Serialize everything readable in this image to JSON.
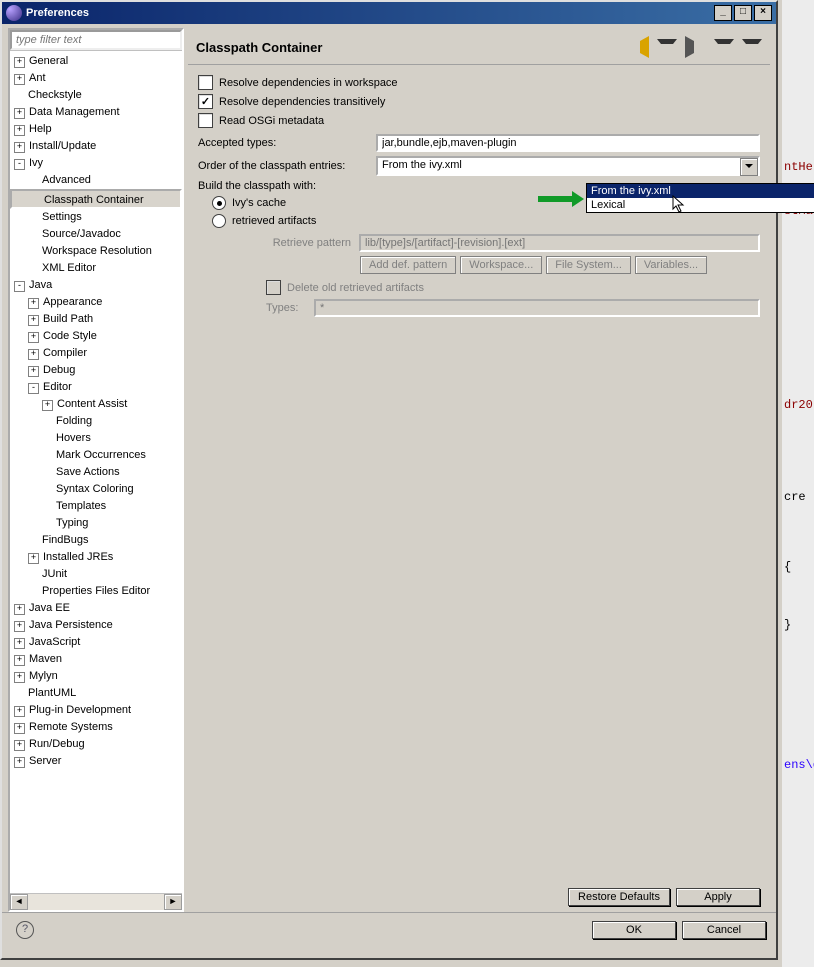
{
  "window": {
    "title": "Preferences"
  },
  "filter": {
    "placeholder": "type filter text"
  },
  "tree": {
    "items": [
      {
        "d": 0,
        "tw": "+",
        "label": "General"
      },
      {
        "d": 0,
        "tw": "+",
        "label": "Ant"
      },
      {
        "d": 0,
        "tw": "",
        "label": "Checkstyle"
      },
      {
        "d": 0,
        "tw": "+",
        "label": "Data Management"
      },
      {
        "d": 0,
        "tw": "+",
        "label": "Help"
      },
      {
        "d": 0,
        "tw": "+",
        "label": "Install/Update"
      },
      {
        "d": 0,
        "tw": "-",
        "label": "Ivy"
      },
      {
        "d": 1,
        "tw": "",
        "label": "Advanced"
      },
      {
        "d": 1,
        "tw": "",
        "label": "Classpath Container",
        "sel": true
      },
      {
        "d": 1,
        "tw": "",
        "label": "Settings"
      },
      {
        "d": 1,
        "tw": "",
        "label": "Source/Javadoc"
      },
      {
        "d": 1,
        "tw": "",
        "label": "Workspace Resolution"
      },
      {
        "d": 1,
        "tw": "",
        "label": "XML Editor"
      },
      {
        "d": 0,
        "tw": "-",
        "label": "Java"
      },
      {
        "d": 1,
        "tw": "+",
        "label": "Appearance"
      },
      {
        "d": 1,
        "tw": "+",
        "label": "Build Path"
      },
      {
        "d": 1,
        "tw": "+",
        "label": "Code Style"
      },
      {
        "d": 1,
        "tw": "+",
        "label": "Compiler"
      },
      {
        "d": 1,
        "tw": "+",
        "label": "Debug"
      },
      {
        "d": 1,
        "tw": "-",
        "label": "Editor"
      },
      {
        "d": 2,
        "tw": "+",
        "label": "Content Assist"
      },
      {
        "d": 2,
        "tw": "",
        "label": "Folding"
      },
      {
        "d": 2,
        "tw": "",
        "label": "Hovers"
      },
      {
        "d": 2,
        "tw": "",
        "label": "Mark Occurrences"
      },
      {
        "d": 2,
        "tw": "",
        "label": "Save Actions"
      },
      {
        "d": 2,
        "tw": "",
        "label": "Syntax Coloring"
      },
      {
        "d": 2,
        "tw": "",
        "label": "Templates"
      },
      {
        "d": 2,
        "tw": "",
        "label": "Typing"
      },
      {
        "d": 1,
        "tw": "",
        "label": "FindBugs"
      },
      {
        "d": 1,
        "tw": "+",
        "label": "Installed JREs"
      },
      {
        "d": 1,
        "tw": "",
        "label": "JUnit"
      },
      {
        "d": 1,
        "tw": "",
        "label": "Properties Files Editor"
      },
      {
        "d": 0,
        "tw": "+",
        "label": "Java EE"
      },
      {
        "d": 0,
        "tw": "+",
        "label": "Java Persistence"
      },
      {
        "d": 0,
        "tw": "+",
        "label": "JavaScript"
      },
      {
        "d": 0,
        "tw": "+",
        "label": "Maven"
      },
      {
        "d": 0,
        "tw": "+",
        "label": "Mylyn"
      },
      {
        "d": 0,
        "tw": "",
        "label": "PlantUML"
      },
      {
        "d": 0,
        "tw": "+",
        "label": "Plug-in Development"
      },
      {
        "d": 0,
        "tw": "+",
        "label": "Remote Systems"
      },
      {
        "d": 0,
        "tw": "+",
        "label": "Run/Debug"
      },
      {
        "d": 0,
        "tw": "+",
        "label": "Server"
      }
    ]
  },
  "page": {
    "title": "Classpath Container",
    "resolve_workspace": "Resolve dependencies in workspace",
    "resolve_transitive": "Resolve dependencies transitively",
    "read_osgi": "Read OSGi metadata",
    "accepted_types_label": "Accepted types:",
    "accepted_types_value": "jar,bundle,ejb,maven-plugin",
    "order_label": "Order of the classpath entries:",
    "order_value": "From the ivy.xml",
    "order_options": [
      "From the ivy.xml",
      "Lexical"
    ],
    "build_with_label": "Build the classpath with:",
    "radio_cache": "Ivy's cache",
    "radio_retrieved": "retrieved artifacts",
    "retrieve_pattern_label": "Retrieve pattern",
    "retrieve_pattern_placeholder": "lib/[type]s/[artifact]-[revision].[ext]",
    "btn_add_def": "Add def. pattern",
    "btn_workspace": "Workspace...",
    "btn_filesystem": "File System...",
    "btn_variables": "Variables...",
    "delete_old": "Delete old retrieved artifacts",
    "types_label": "Types:",
    "types_placeholder": "*"
  },
  "buttons": {
    "restore": "Restore Defaults",
    "apply": "Apply",
    "ok": "OK",
    "cancel": "Cancel"
  },
  "bg": {
    "t1": "ntHe",
    "t2": "stMa",
    "t3": "dr20",
    "t4": "cre",
    "t5": "{",
    "t6": "}",
    "t7": "ens\\d"
  }
}
